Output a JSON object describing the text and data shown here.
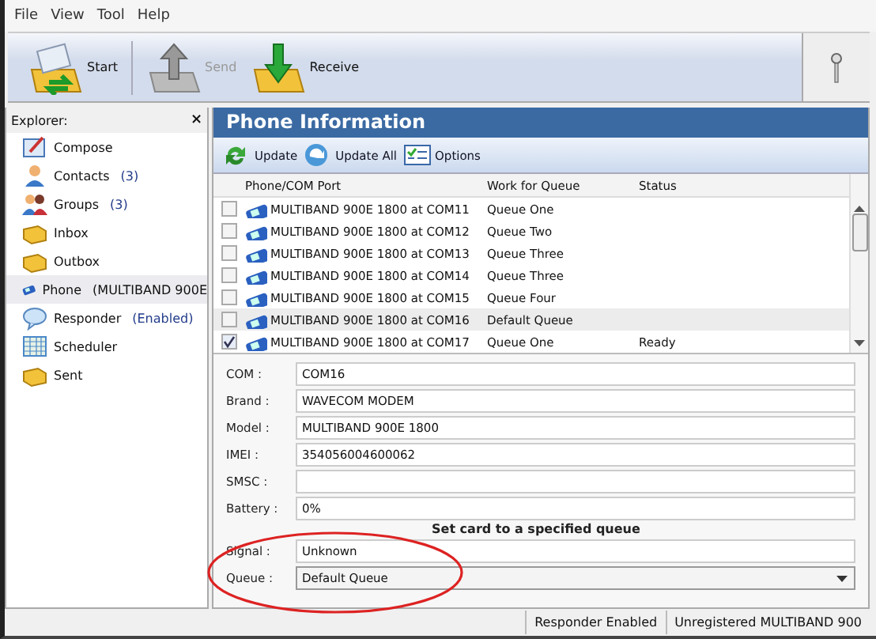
{
  "menu": [
    "File",
    "View",
    "Tool",
    "Help"
  ],
  "toolbar": [
    {
      "label": "Start",
      "kind": "start",
      "disabled": false
    },
    {
      "label": "Send",
      "kind": "send",
      "disabled": true
    },
    {
      "label": "Receive",
      "kind": "receive",
      "disabled": false
    }
  ],
  "explorer": {
    "title": "Explorer:",
    "close": "×",
    "items": [
      {
        "label": "Compose",
        "kind": "compose",
        "selected": false
      },
      {
        "label": "Contacts",
        "badge": "(3)",
        "kind": "contact",
        "selected": false
      },
      {
        "label": "Groups",
        "badge": "(3)",
        "kind": "group",
        "selected": false
      },
      {
        "label": "Inbox",
        "kind": "folder",
        "selected": false
      },
      {
        "label": "Outbox",
        "kind": "folder",
        "selected": false
      },
      {
        "label": "Phone",
        "badge": "(MULTIBAND  900E",
        "kind": "phone",
        "selected": true
      },
      {
        "label": "Responder",
        "badge": "(Enabled)",
        "kind": "bubble",
        "selected": false
      },
      {
        "label": "Scheduler",
        "kind": "calendar",
        "selected": false
      },
      {
        "label": "Sent",
        "kind": "folder",
        "selected": false
      }
    ]
  },
  "panel": {
    "title": "Phone Information",
    "actions": [
      {
        "label": "Update",
        "kind": "update"
      },
      {
        "label": "Update All",
        "kind": "update_all"
      },
      {
        "label": "Options",
        "kind": "options"
      }
    ],
    "table": {
      "columns": [
        "Phone/COM Port",
        "Work for Queue",
        "Status"
      ],
      "rows": [
        {
          "port": "MULTIBAND  900E  1800  at COM11",
          "queue": "Queue One",
          "checked": false,
          "selected": false
        },
        {
          "port": "MULTIBAND  900E  1800  at COM12",
          "queue": "Queue Two",
          "checked": false,
          "selected": false
        },
        {
          "port": "MULTIBAND  900E  1800  at COM13",
          "queue": "Queue Three",
          "checked": false,
          "selected": false
        },
        {
          "port": "MULTIBAND  900E  1800  at COM14",
          "queue": "Queue Three",
          "checked": false,
          "selected": false
        },
        {
          "port": "MULTIBAND  900E  1800  at COM15",
          "queue": "Queue Four",
          "checked": false,
          "selected": false
        },
        {
          "port": "MULTIBAND  900E  1800  at COM16",
          "queue": "Default Queue",
          "checked": false,
          "selected": true
        },
        {
          "port": "MULTIBAND  900E  1800  at COM17",
          "queue": "Queue One",
          "status": "Ready",
          "checked": true,
          "selected": false
        }
      ]
    },
    "fields": [
      {
        "label": "COM :",
        "value": "COM16",
        "kind": "text"
      },
      {
        "label": "Brand :",
        "value": "WAVECOM MODEM",
        "kind": "text"
      },
      {
        "label": "Model :",
        "value": "MULTIBAND  900E  1800",
        "kind": "text"
      },
      {
        "label": "IMEI :",
        "value": "354056004600062",
        "kind": "text"
      },
      {
        "label": "SMSC :",
        "kind": "text"
      },
      {
        "label": "Battery :",
        "value": "0%",
        "kind": "text"
      },
      {
        "label": "Signal :",
        "value": "Unknown",
        "kind": "text"
      },
      {
        "label": "Queue :",
        "value": "Default Queue",
        "kind": "dropdown"
      }
    ]
  },
  "annotation": "Set  card to a specified queue",
  "status_bar": [
    "Responder Enabled",
    "Unregistered  MULTIBAND  900"
  ]
}
